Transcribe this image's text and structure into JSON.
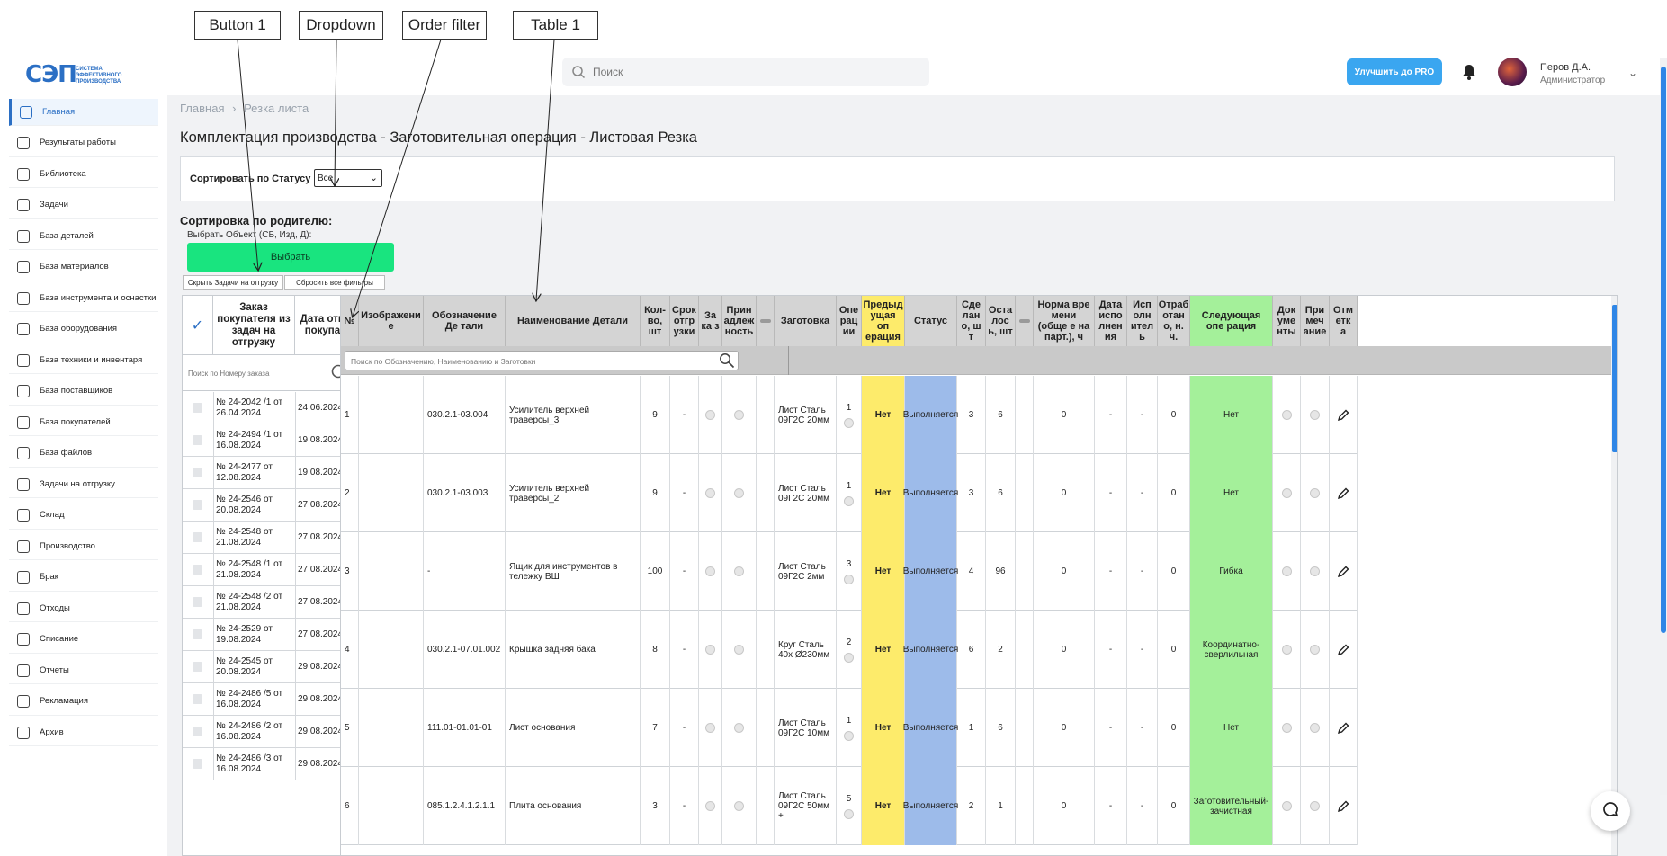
{
  "annotations": {
    "button1": "Button 1",
    "dropdown": "Dropdown",
    "order_filter": "Order filter",
    "table1": "Table 1"
  },
  "logo": {
    "mark": "СЭП",
    "text_line1": "система",
    "text_line2": "эффективного",
    "text_line3": "производства"
  },
  "search": {
    "placeholder": "Поиск"
  },
  "header": {
    "pro_button": "Улучшить до PRO",
    "user_name": "Перов Д.А.",
    "user_role": "Администратор"
  },
  "sidebar": {
    "items": [
      {
        "label": "Главная",
        "icon": "home-icon"
      },
      {
        "label": "Результаты работы",
        "icon": "chart-icon"
      },
      {
        "label": "Библиотека",
        "icon": "book-icon"
      },
      {
        "label": "Задачи",
        "icon": "task-icon"
      },
      {
        "label": "База деталей",
        "icon": "database-icon"
      },
      {
        "label": "База материалов",
        "icon": "database-icon"
      },
      {
        "label": "База инструмента и оснастки",
        "icon": "database-icon"
      },
      {
        "label": "База оборудования",
        "icon": "database-icon"
      },
      {
        "label": "База техники и инвентаря",
        "icon": "database-icon"
      },
      {
        "label": "База поставщиков",
        "icon": "database-icon"
      },
      {
        "label": "База покупателей",
        "icon": "users-icon"
      },
      {
        "label": "База файлов",
        "icon": "database-icon"
      },
      {
        "label": "Задачи на отгрузку",
        "icon": "cloud-upload-icon"
      },
      {
        "label": "Склад",
        "icon": "warehouse-icon"
      },
      {
        "label": "Производство",
        "icon": "factory-icon"
      },
      {
        "label": "Брак",
        "icon": "defect-icon"
      },
      {
        "label": "Отходы",
        "icon": "recycle-icon"
      },
      {
        "label": "Списание",
        "icon": "writeoff-icon"
      },
      {
        "label": "Отчеты",
        "icon": "report-icon"
      },
      {
        "label": "Рекламация",
        "icon": "shield-icon"
      },
      {
        "label": "Архив",
        "icon": "archive-icon"
      }
    ]
  },
  "breadcrumb": {
    "home": "Главная",
    "sep": "›",
    "current": "Резка листа"
  },
  "page": {
    "title": "Комплектация производства - Заготовительная операция - Листовая Резка",
    "sort_label": "Сортировать по Статусу",
    "sort_value": "Все",
    "parent_title": "Сортировка по родителю:",
    "pick_label": "Выбрать Объект (СБ, Изд, Д):",
    "pick_button": "Выбрать",
    "hide_shipping": "Скрыть Задачи на отгрузку",
    "reset_filters": "Сбросить все фильтры"
  },
  "order_table": {
    "headers": [
      "Заказ покупателя из задач на отгрузку",
      "Дата отгрузки покупателю"
    ],
    "search_placeholder": "Поиск по Номеру заказа",
    "rows": [
      {
        "order": "№ 24-2042 /1 от 26.04.2024",
        "date": "24.06.2024"
      },
      {
        "order": "№ 24-2494 /1 от 16.08.2024",
        "date": "19.08.2024"
      },
      {
        "order": "№ 24-2477 от 12.08.2024",
        "date": "19.08.2024"
      },
      {
        "order": "№ 24-2546 от 20.08.2024",
        "date": "27.08.2024"
      },
      {
        "order": "№ 24-2548 от 21.08.2024",
        "date": "27.08.2024"
      },
      {
        "order": "№ 24-2548 /1 от 21.08.2024",
        "date": "27.08.2024"
      },
      {
        "order": "№ 24-2548 /2 от 21.08.2024",
        "date": "27.08.2024"
      },
      {
        "order": "№ 24-2529 от 19.08.2024",
        "date": "27.08.2024"
      },
      {
        "order": "№ 24-2545 от 20.08.2024",
        "date": "29.08.2024"
      },
      {
        "order": "№ 24-2486 /5 от 16.08.2024",
        "date": "29.08.2024"
      },
      {
        "order": "№ 24-2486 /2 от 16.08.2024",
        "date": "29.08.2024"
      },
      {
        "order": "№ 24-2486 /3 от 16.08.2024",
        "date": "29.08.2024"
      }
    ]
  },
  "main_table": {
    "headers": [
      "№",
      "Изображение",
      "Обозначение Детали",
      "Наименование Детали",
      "Кол-во, шт",
      "Срок отгрузки",
      "Заказ",
      "Принадлежность",
      "",
      "Заготовка",
      "Операции",
      "Предыдущая операция",
      "Статус",
      "Сделано, шт",
      "Осталось, шт",
      "",
      "Норма времени (общее на парт.), ч",
      "Дата исполнения",
      "Исполнитель",
      "Отработано, н. ч.",
      "Следующая операция",
      "Документы",
      "Примечание",
      "Отметка"
    ],
    "header_display": [
      "№",
      "Изображени е",
      "Обозначение Де тали",
      "Наименование Детали",
      "Кол- во, шт",
      "Срок отгр узки",
      "За ка з",
      "Прин адлеж ность",
      "",
      "Заготовка",
      "Опе рац ии",
      "Предыд ущая оп ерация",
      "Статус",
      "Сде лан о, ш т",
      "Оста лос ь, шт",
      "",
      "Норма вре мени (обще е на парт.), ч",
      "Дата испо лнен ия",
      "Исп олн ител ь",
      "Отраб отан о, н. ч.",
      "Следующая опе рация",
      "Док уме нты",
      "При меч ание",
      "Отм етк а"
    ],
    "search_placeholder": "Поиск по Обозначению, Наименованию и Заготовки",
    "rows": [
      {
        "n": "1",
        "code": "030.2.1-03.004",
        "name": "Усилитель верхней траверсы_3",
        "qty": "9",
        "term": "-",
        "blank": "Лист Сталь 09Г2С 20мм",
        "ops": "1",
        "prev": "Нет",
        "status": "Выполняется",
        "done": "3",
        "left": "6",
        "norm": "0",
        "date": "-",
        "worker": "-",
        "worked": "0",
        "next": "Нет"
      },
      {
        "n": "2",
        "code": "030.2.1-03.003",
        "name": "Усилитель верхней траверсы_2",
        "qty": "9",
        "term": "-",
        "blank": "Лист Сталь 09Г2С 20мм",
        "ops": "1",
        "prev": "Нет",
        "status": "Выполняется",
        "done": "3",
        "left": "6",
        "norm": "0",
        "date": "-",
        "worker": "-",
        "worked": "0",
        "next": "Нет"
      },
      {
        "n": "3",
        "code": "-",
        "name": "Ящик для инструментов в тележку ВШ",
        "qty": "100",
        "term": "-",
        "blank": "Лист Сталь 09Г2С 2мм",
        "ops": "3",
        "prev": "Нет",
        "status": "Выполняется",
        "done": "4",
        "left": "96",
        "norm": "0",
        "date": "-",
        "worker": "-",
        "worked": "0",
        "next": "Гибка"
      },
      {
        "n": "4",
        "code": "030.2.1-07.01.002",
        "name": "Крышка задняя бака",
        "qty": "8",
        "term": "-",
        "blank": "Круг Сталь 40х Ø230мм",
        "ops": "2",
        "prev": "Нет",
        "status": "Выполняется",
        "done": "6",
        "left": "2",
        "norm": "0",
        "date": "-",
        "worker": "-",
        "worked": "0",
        "next": "Координатно-сверлильная"
      },
      {
        "n": "5",
        "code": "111.01-01.01-01",
        "name": "Лист основания",
        "qty": "7",
        "term": "-",
        "blank": "Лист Сталь 09Г2С 10мм",
        "ops": "1",
        "prev": "Нет",
        "status": "Выполняется",
        "done": "1",
        "left": "6",
        "norm": "0",
        "date": "-",
        "worker": "-",
        "worked": "0",
        "next": "Нет"
      },
      {
        "n": "6",
        "code": "085.1.2.4.1.2.1.1",
        "name": "Плита основания",
        "qty": "3",
        "term": "-",
        "blank": "Лист Сталь 09Г2С 50мм +",
        "ops": "5",
        "prev": "Нет",
        "status": "Выполняется",
        "done": "2",
        "left": "1",
        "norm": "0",
        "date": "-",
        "worker": "-",
        "worked": "0",
        "next": "Заготовительный-зачистная"
      }
    ]
  },
  "colors": {
    "accent": "#2b6fc4",
    "pick_button": "#19e47f",
    "prev_op_yellow": "#fdeb6b",
    "status_blue": "#9dbbea",
    "next_op_green": "#a4f09a",
    "pro_button": "#3aa6f0"
  }
}
